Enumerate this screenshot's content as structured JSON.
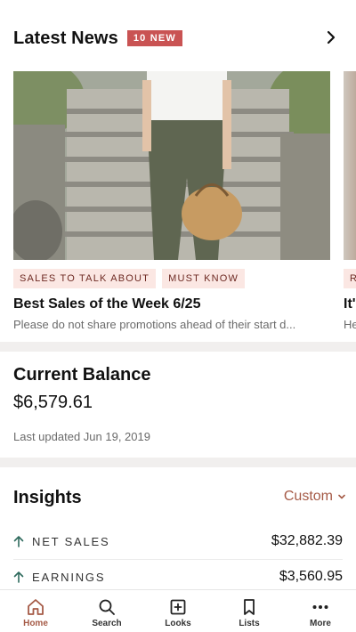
{
  "news": {
    "title": "Latest News",
    "badge": "10 NEW",
    "cards": [
      {
        "tags": [
          "SALES TO TALK ABOUT",
          "MUST KNOW"
        ],
        "title": "Best Sales of the Week 6/25",
        "subtitle": "Please do not share promotions ahead of their start d..."
      },
      {
        "tags": [
          "R"
        ],
        "title": "It'",
        "subtitle": "He"
      }
    ]
  },
  "balance": {
    "title": "Current Balance",
    "amount": "$6,579.61",
    "updated": "Last updated Jun 19, 2019"
  },
  "insights": {
    "title": "Insights",
    "range": "Custom",
    "metrics": [
      {
        "label": "NET SALES",
        "value": "$32,882.39",
        "trend": "up"
      },
      {
        "label": "EARNINGS",
        "value": "$3,560.95",
        "trend": "up"
      }
    ]
  },
  "tabbar": {
    "items": [
      {
        "label": "Home",
        "icon": "home-icon",
        "active": true
      },
      {
        "label": "Search",
        "icon": "search-icon",
        "active": false
      },
      {
        "label": "Looks",
        "icon": "plus-square-icon",
        "active": false
      },
      {
        "label": "Lists",
        "icon": "bookmark-icon",
        "active": false
      },
      {
        "label": "More",
        "icon": "more-dots-icon",
        "active": false
      }
    ]
  },
  "colors": {
    "accent": "#a55a46",
    "badge": "#c95353",
    "tag_bg": "#fbe7e3",
    "trend_up": "#2f6b5e"
  }
}
